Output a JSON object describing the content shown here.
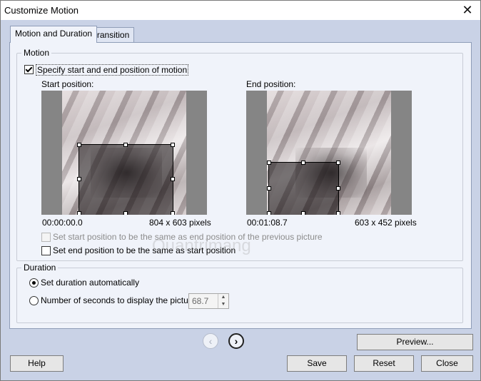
{
  "window": {
    "title": "Customize Motion",
    "close_glyph": "✕"
  },
  "tabs": [
    {
      "label": "Motion and Duration"
    },
    {
      "label": "Transition"
    }
  ],
  "motion": {
    "group_label": "Motion",
    "specify_label": "Specify start and end position of motion",
    "specify_checked": true,
    "start_label": "Start position:",
    "end_label": "End position:",
    "start_time": "00:00:00.0",
    "start_size": "804 x 603 pixels",
    "end_time": "00:01:08.7",
    "end_size": "603 x 452 pixels",
    "same_start_label": "Set start position to be the same as end position of the previous picture",
    "same_start_checked": false,
    "same_end_label": "Set end position to be the same as start position",
    "same_end_checked": false
  },
  "duration": {
    "group_label": "Duration",
    "auto_label": "Set duration automatically",
    "seconds_label": "Number of seconds to display the picture",
    "seconds_value": "68.7",
    "selected": "auto"
  },
  "nav": {
    "prev_glyph": "‹",
    "next_glyph": "›"
  },
  "buttons": {
    "preview": "Preview...",
    "help": "Help",
    "save": "Save",
    "reset": "Reset",
    "close": "Close"
  },
  "watermark": "Quantrimang",
  "icons": {
    "spin_up": "▲",
    "spin_down": "▼"
  }
}
